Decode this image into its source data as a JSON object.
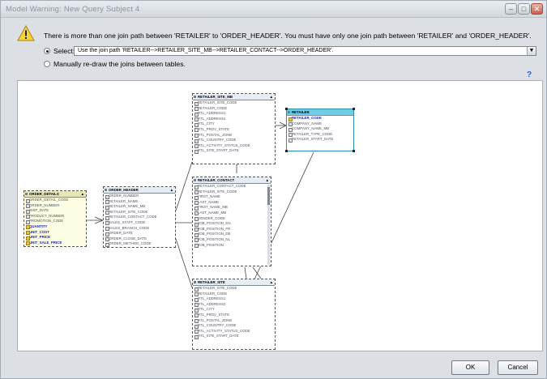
{
  "window": {
    "title": "Model Warning: New Query Subject 4"
  },
  "colors": {
    "selected_table_header": "#6ecfe4",
    "key_text": "#1a2aa6",
    "help_blue": "#2a58c8"
  },
  "warning": {
    "icon": "warning-triangle-icon",
    "message": "There is more than one join path between 'RETAILER' to 'ORDER_HEADER'. You must have only one join path between 'RETAILER' and 'ORDER_HEADER'."
  },
  "options": {
    "select_label": "Select:",
    "select_value": "Use the join path 'RETAILER-->RETAILER_SITE_MB-->RETAILER_CONTACT-->ORDER_HEADER'.",
    "manual_label": "Manually re-draw the joins between tables."
  },
  "help": {
    "glyph": "?"
  },
  "tables": {
    "order_details": {
      "name": "ORDER_DETAILS",
      "columns": [
        "ORDER_DETAIL_CODE",
        "ORDER_NUMBER",
        "SHIP_DATE",
        "PRODUCT_NUMBER",
        "PROMOTION_CODE",
        "QUANTITY",
        "UNIT_COST",
        "UNIT_PRICE",
        "UNIT_SALE_PRICE"
      ]
    },
    "order_header": {
      "name": "ORDER_HEADER",
      "columns": [
        "ORDER_NUMBER",
        "RETAILER_NAME",
        "RETAILER_NAME_MB",
        "RETAILER_SITE_CODE",
        "RETAILER_CONTACT_CODE",
        "SALES_STAFF_CODE",
        "SALES_BRANCH_CODE",
        "ORDER_DATE",
        "ORDER_CLOSE_DATE",
        "ORDER_METHOD_CODE"
      ]
    },
    "retailer_site_mb": {
      "name": "RETAILER_SITE_MB",
      "columns": [
        "RETAILER_SITE_CODE",
        "RETAILER_CODE",
        "RTL_ADDRESS1",
        "RTL_ADDRESS2",
        "RTL_CITY",
        "RTL_PROV_STATE",
        "RTL_POSTAL_ZONE",
        "RTL_COUNTRY_CODE",
        "RTL_ACTIVITY_STATUS_CODE",
        "RTL_SITE_START_DATE"
      ]
    },
    "retailer": {
      "name": "RETAILER",
      "columns": [
        "RETAILER_CODE",
        "COMPANY_NAME",
        "COMPANY_NAME_MB",
        "RETAILER_TYPE_CODE",
        "RETAILER_START_DATE"
      ]
    },
    "retailer_contact": {
      "name": "RETAILER_CONTACT",
      "columns": [
        "RETAILER_CONTACT_CODE",
        "RETAILER_SITE_CODE",
        "FIRST_NAME",
        "LAST_NAME",
        "FIRST_NAME_MB",
        "LAST_NAME_MB",
        "GENDER_CODE",
        "JOB_POSITION_EN",
        "JOB_POSITION_FR",
        "JOB_POSITION_DE",
        "JOB_POSITION_NL",
        "JOB_POSITION"
      ]
    },
    "retailer_site": {
      "name": "RETAILER_SITE",
      "columns": [
        "RETAILER_SITE_CODE",
        "RETAILER_CODE",
        "RTL_ADDRESS1",
        "RTL_ADDRESS2",
        "RTL_CITY",
        "RTL_PROV_STATE",
        "RTL_POSTAL_ZONE",
        "RTL_COUNTRY_CODE",
        "RTL_ACTIVITY_STATUS_CODE",
        "RTL_SITE_START_DATE"
      ]
    }
  },
  "buttons": {
    "ok": "OK",
    "cancel": "Cancel"
  }
}
